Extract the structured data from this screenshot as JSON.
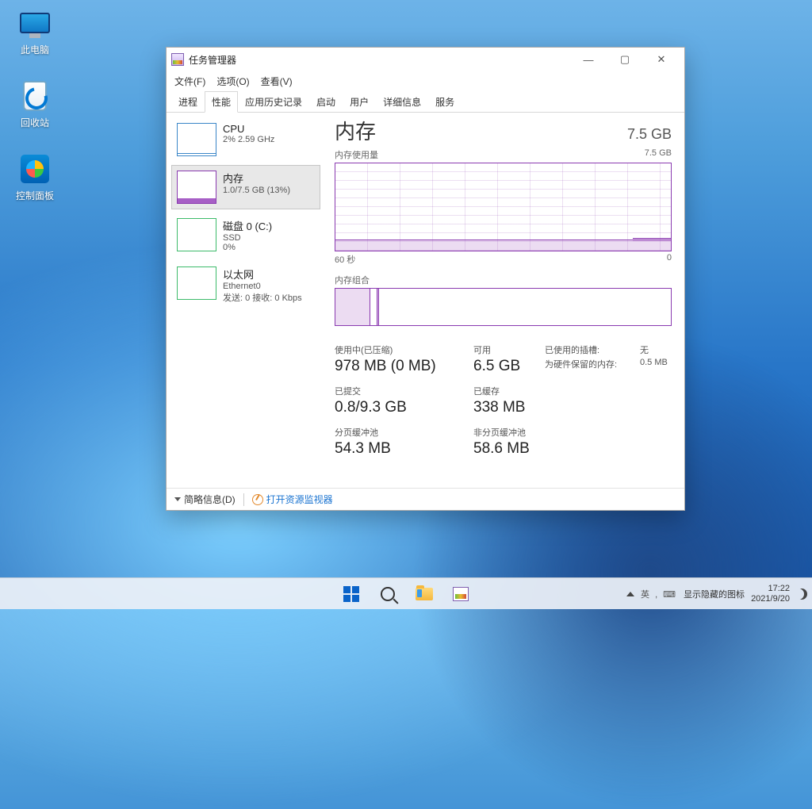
{
  "desktop": {
    "icons": [
      {
        "name": "此电脑"
      },
      {
        "name": "回收站"
      },
      {
        "name": "控制面板"
      }
    ]
  },
  "window": {
    "title": "任务管理器",
    "menu": {
      "file": "文件(F)",
      "options": "选项(O)",
      "view": "查看(V)"
    },
    "tabs": [
      "进程",
      "性能",
      "应用历史记录",
      "启动",
      "用户",
      "详细信息",
      "服务"
    ],
    "active_tab": "性能"
  },
  "sidebar": {
    "cpu": {
      "title": "CPU",
      "sub": "2% 2.59 GHz"
    },
    "mem": {
      "title": "内存",
      "sub": "1.0/7.5 GB (13%)"
    },
    "disk": {
      "title": "磁盘 0 (C:)",
      "sub": "SSD",
      "sub2": "0%"
    },
    "eth": {
      "title": "以太网",
      "sub": "Ethernet0",
      "sub2": "发送: 0 接收: 0 Kbps"
    }
  },
  "main": {
    "heading": "内存",
    "capacity": "7.5 GB",
    "usage_label": "内存使用量",
    "usage_scale": "7.5 GB",
    "axis_left": "60 秒",
    "axis_right": "0",
    "comp_label": "内存组合"
  },
  "stats": {
    "in_use_label": "使用中(已压缩)",
    "in_use_val": "978 MB (0 MB)",
    "avail_label": "可用",
    "avail_val": "6.5 GB",
    "slots_label": "已使用的插槽:",
    "slots_val": "无",
    "hw_label": "为硬件保留的内存:",
    "hw_val": "0.5 MB",
    "commit_label": "已提交",
    "commit_val": "0.8/9.3 GB",
    "cached_label": "已缓存",
    "cached_val": "338 MB",
    "paged_label": "分页缓冲池",
    "paged_val": "54.3 MB",
    "nonpaged_label": "非分页缓冲池",
    "nonpaged_val": "58.6 MB"
  },
  "footer": {
    "summary": "简略信息(D)",
    "resmon": "打开资源监视器"
  },
  "tray": {
    "tooltip": "显示隐藏的图标",
    "time": "17:22",
    "date": "2021/9/20"
  }
}
